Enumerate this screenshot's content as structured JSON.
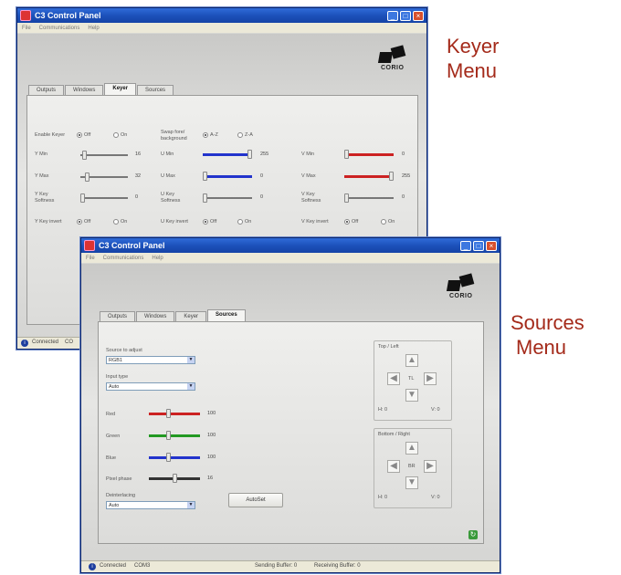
{
  "captions": {
    "keyer": [
      "Keyer",
      "Menu"
    ],
    "sources": [
      "Sources",
      "Menu"
    ]
  },
  "window_title": "C3 Control Panel",
  "window_buttons": {
    "minimize": "_",
    "maximize": "□",
    "close": "×"
  },
  "menu": [
    "File",
    "Communications",
    "Help"
  ],
  "logo_text": "CORIO",
  "tabs": [
    "Outputs",
    "Windows",
    "Keyer",
    "Sources"
  ],
  "keyer": {
    "enable": {
      "label": "Enable Keyer",
      "options": [
        "Off",
        "On"
      ],
      "selected": "Off"
    },
    "swap": {
      "label_line1": "Swap fore/",
      "label_line2": "background",
      "options": [
        "A-Z",
        "Z-A"
      ],
      "selected": "A-Z"
    },
    "y": {
      "min": {
        "label": "Y Min",
        "value": "16",
        "level": 0.05
      },
      "max": {
        "label": "Y Max",
        "value": "32",
        "level": 0.1
      },
      "soft": {
        "label_line1": "Y Key",
        "label_line2": "Softness",
        "value": "0",
        "level": 0.0
      },
      "invert": {
        "label": "Y Key invert",
        "options": [
          "Off",
          "On"
        ],
        "selected": "Off"
      }
    },
    "u": {
      "min": {
        "label": "U Min",
        "value": "255",
        "level": 1.0
      },
      "max": {
        "label": "U Max",
        "value": "0",
        "level": 0.0
      },
      "soft": {
        "label_line1": "U Key",
        "label_line2": "Softness",
        "value": "0",
        "level": 0.0
      },
      "invert": {
        "label": "U Key invert",
        "options": [
          "Off",
          "On"
        ],
        "selected": "Off"
      }
    },
    "v": {
      "min": {
        "label": "V Min",
        "value": "0",
        "level": 0.0
      },
      "max": {
        "label": "V Max",
        "value": "255",
        "level": 1.0
      },
      "soft": {
        "label_line1": "V Key",
        "label_line2": "Softness",
        "value": "0",
        "level": 0.0
      },
      "invert": {
        "label": "V Key invert",
        "options": [
          "Off",
          "On"
        ],
        "selected": "Off"
      }
    }
  },
  "keyer_status": {
    "text": "Connected",
    "port": "CO"
  },
  "sources": {
    "source_label": "Source to adjust",
    "source_value": "RGB1",
    "input_type_label": "Input type",
    "input_type_value": "Auto",
    "red": {
      "label": "Red",
      "value": "100",
      "level": 0.38
    },
    "green": {
      "label": "Green",
      "value": "100",
      "level": 0.38
    },
    "blue": {
      "label": "Blue",
      "value": "100",
      "level": 0.38
    },
    "pixel_phase": {
      "label": "Pixel phase",
      "value": "16",
      "level": 0.5
    },
    "deinterlacing_label": "Deinterlacing",
    "deinterlacing_value": "Auto",
    "autoset_label": "AutoSet",
    "top_left": {
      "title": "Top / Left",
      "center": "TL",
      "h": "H: 0",
      "v": "V: 0"
    },
    "bottom_right": {
      "title": "Bottom / Right",
      "center": "BR",
      "h": "H: 0",
      "v": "V: 0"
    }
  },
  "sources_status": {
    "text": "Connected",
    "port": "COM3",
    "sending": "Sending Buffer: 0",
    "receiving": "Receiving Buffer: 0"
  },
  "colors": {
    "caption": "#a42a1a",
    "title_bar": "#1b4fb8",
    "red_slider": "#cc2222",
    "green_slider": "#229922",
    "blue_slider": "#2233cc"
  }
}
